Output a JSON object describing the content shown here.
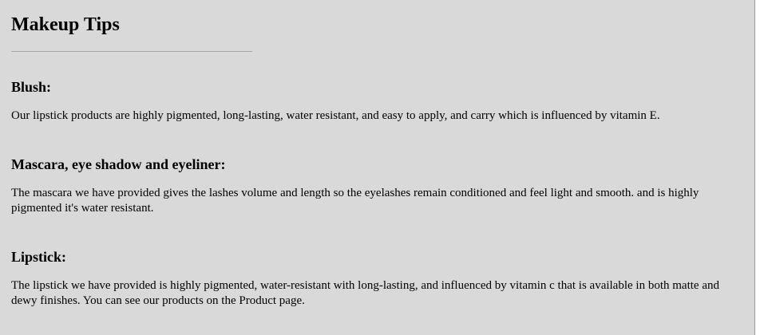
{
  "page": {
    "title": "Makeup Tips"
  },
  "sections": [
    {
      "heading": "Blush:",
      "body": "Our lipstick products are highly pigmented, long-lasting, water resistant, and easy to apply, and carry which is influenced by vitamin E."
    },
    {
      "heading": "Mascara, eye shadow and eyeliner:",
      "body": "The mascara we have provided gives the lashes volume and length so the eyelashes remain conditioned and feel light and smooth. and is highly pigmented it's water resistant."
    },
    {
      "heading": "Lipstick:",
      "body": "The lipstick we have provided is highly pigmented, water-resistant with long-lasting, and influenced by vitamin c that is available in both matte and dewy finishes. You can see our products on the Product page."
    }
  ],
  "colors": {
    "background": "#d9d9d9",
    "text": "#000000",
    "divider": "#a8a8a8"
  }
}
